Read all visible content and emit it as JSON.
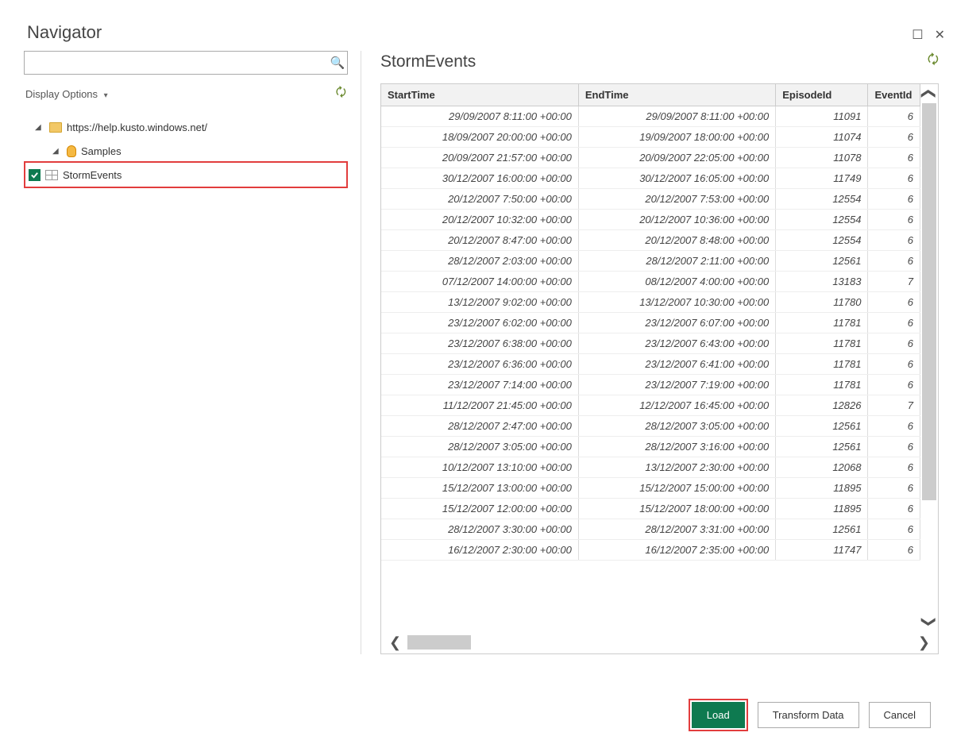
{
  "window_title": "Navigator",
  "display_options_label": "Display Options",
  "tree": {
    "root": {
      "label": "https://help.kusto.windows.net/"
    },
    "db": {
      "label": "Samples"
    },
    "table": {
      "label": "StormEvents",
      "checked": true
    }
  },
  "preview": {
    "title": "StormEvents",
    "columns": [
      "StartTime",
      "EndTime",
      "EpisodeId",
      "EventId"
    ],
    "rows": [
      {
        "StartTime": "29/09/2007 8:11:00 +00:00",
        "EndTime": "29/09/2007 8:11:00 +00:00",
        "EpisodeId": "11091",
        "EventId": "6"
      },
      {
        "StartTime": "18/09/2007 20:00:00 +00:00",
        "EndTime": "19/09/2007 18:00:00 +00:00",
        "EpisodeId": "11074",
        "EventId": "6"
      },
      {
        "StartTime": "20/09/2007 21:57:00 +00:00",
        "EndTime": "20/09/2007 22:05:00 +00:00",
        "EpisodeId": "11078",
        "EventId": "6"
      },
      {
        "StartTime": "30/12/2007 16:00:00 +00:00",
        "EndTime": "30/12/2007 16:05:00 +00:00",
        "EpisodeId": "11749",
        "EventId": "6"
      },
      {
        "StartTime": "20/12/2007 7:50:00 +00:00",
        "EndTime": "20/12/2007 7:53:00 +00:00",
        "EpisodeId": "12554",
        "EventId": "6"
      },
      {
        "StartTime": "20/12/2007 10:32:00 +00:00",
        "EndTime": "20/12/2007 10:36:00 +00:00",
        "EpisodeId": "12554",
        "EventId": "6"
      },
      {
        "StartTime": "20/12/2007 8:47:00 +00:00",
        "EndTime": "20/12/2007 8:48:00 +00:00",
        "EpisodeId": "12554",
        "EventId": "6"
      },
      {
        "StartTime": "28/12/2007 2:03:00 +00:00",
        "EndTime": "28/12/2007 2:11:00 +00:00",
        "EpisodeId": "12561",
        "EventId": "6"
      },
      {
        "StartTime": "07/12/2007 14:00:00 +00:00",
        "EndTime": "08/12/2007 4:00:00 +00:00",
        "EpisodeId": "13183",
        "EventId": "7"
      },
      {
        "StartTime": "13/12/2007 9:02:00 +00:00",
        "EndTime": "13/12/2007 10:30:00 +00:00",
        "EpisodeId": "11780",
        "EventId": "6"
      },
      {
        "StartTime": "23/12/2007 6:02:00 +00:00",
        "EndTime": "23/12/2007 6:07:00 +00:00",
        "EpisodeId": "11781",
        "EventId": "6"
      },
      {
        "StartTime": "23/12/2007 6:38:00 +00:00",
        "EndTime": "23/12/2007 6:43:00 +00:00",
        "EpisodeId": "11781",
        "EventId": "6"
      },
      {
        "StartTime": "23/12/2007 6:36:00 +00:00",
        "EndTime": "23/12/2007 6:41:00 +00:00",
        "EpisodeId": "11781",
        "EventId": "6"
      },
      {
        "StartTime": "23/12/2007 7:14:00 +00:00",
        "EndTime": "23/12/2007 7:19:00 +00:00",
        "EpisodeId": "11781",
        "EventId": "6"
      },
      {
        "StartTime": "11/12/2007 21:45:00 +00:00",
        "EndTime": "12/12/2007 16:45:00 +00:00",
        "EpisodeId": "12826",
        "EventId": "7"
      },
      {
        "StartTime": "28/12/2007 2:47:00 +00:00",
        "EndTime": "28/12/2007 3:05:00 +00:00",
        "EpisodeId": "12561",
        "EventId": "6"
      },
      {
        "StartTime": "28/12/2007 3:05:00 +00:00",
        "EndTime": "28/12/2007 3:16:00 +00:00",
        "EpisodeId": "12561",
        "EventId": "6"
      },
      {
        "StartTime": "10/12/2007 13:10:00 +00:00",
        "EndTime": "13/12/2007 2:30:00 +00:00",
        "EpisodeId": "12068",
        "EventId": "6"
      },
      {
        "StartTime": "15/12/2007 13:00:00 +00:00",
        "EndTime": "15/12/2007 15:00:00 +00:00",
        "EpisodeId": "11895",
        "EventId": "6"
      },
      {
        "StartTime": "15/12/2007 12:00:00 +00:00",
        "EndTime": "15/12/2007 18:00:00 +00:00",
        "EpisodeId": "11895",
        "EventId": "6"
      },
      {
        "StartTime": "28/12/2007 3:30:00 +00:00",
        "EndTime": "28/12/2007 3:31:00 +00:00",
        "EpisodeId": "12561",
        "EventId": "6"
      },
      {
        "StartTime": "16/12/2007 2:30:00 +00:00",
        "EndTime": "16/12/2007 2:35:00 +00:00",
        "EpisodeId": "11747",
        "EventId": "6"
      }
    ]
  },
  "buttons": {
    "load": "Load",
    "transform": "Transform Data",
    "cancel": "Cancel"
  }
}
